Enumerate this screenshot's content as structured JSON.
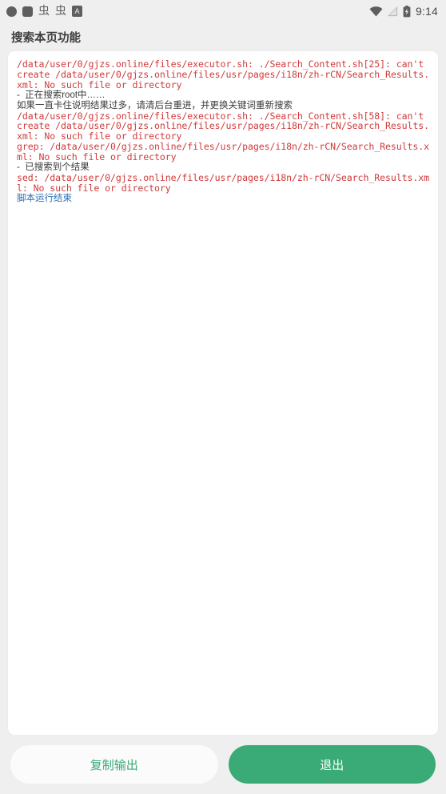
{
  "status_bar": {
    "notifications": [
      {
        "name": "notification-dot-icon",
        "glyph": ""
      },
      {
        "name": "notification-square-icon",
        "glyph": ""
      },
      {
        "name": "bug-icon-1",
        "glyph": "虫"
      },
      {
        "name": "bug-icon-2",
        "glyph": "虫"
      },
      {
        "name": "app-badge-icon",
        "glyph": "A"
      }
    ],
    "wifi_icon": "wifi-icon",
    "signal_icon": "signal-icon",
    "battery_icon": "battery-icon",
    "time": "9:14"
  },
  "header": {
    "title": "搜索本页功能"
  },
  "output": {
    "lines": [
      {
        "type": "err",
        "text": "/data/user/0/gjzs.online/files/executor.sh: ./Search_Content.sh[25]: can't create /data/user/0/gjzs.online/files/usr/pages/i18n/zh-rCN/Search_Results.xml: No such file or directory"
      },
      {
        "type": "info",
        "text": "-  正在搜索root中……"
      },
      {
        "type": "info",
        "text": "如果一直卡住说明结果过多，请清后台重进，并更换关键词重新搜索"
      },
      {
        "type": "err",
        "text": "/data/user/0/gjzs.online/files/executor.sh: ./Search_Content.sh[58]: can't create /data/user/0/gjzs.online/files/usr/pages/i18n/zh-rCN/Search_Results.xml: No such file or directory"
      },
      {
        "type": "err",
        "text": "grep: /data/user/0/gjzs.online/files/usr/pages/i18n/zh-rCN/Search_Results.xml: No such file or directory"
      },
      {
        "type": "info",
        "text": "-  已搜索到个结果"
      },
      {
        "type": "err",
        "text": "sed: /data/user/0/gjzs.online/files/usr/pages/i18n/zh-rCN/Search_Results.xml: No such file or directory"
      },
      {
        "type": "done",
        "text": "脚本运行结束"
      }
    ]
  },
  "footer": {
    "copy_label": "复制输出",
    "exit_label": "退出"
  },
  "colors": {
    "accent_green": "#3aab76",
    "error_red": "#cf3b3b",
    "done_blue": "#2f6fb5",
    "page_bg": "#efefef",
    "panel_bg": "#ffffff"
  }
}
